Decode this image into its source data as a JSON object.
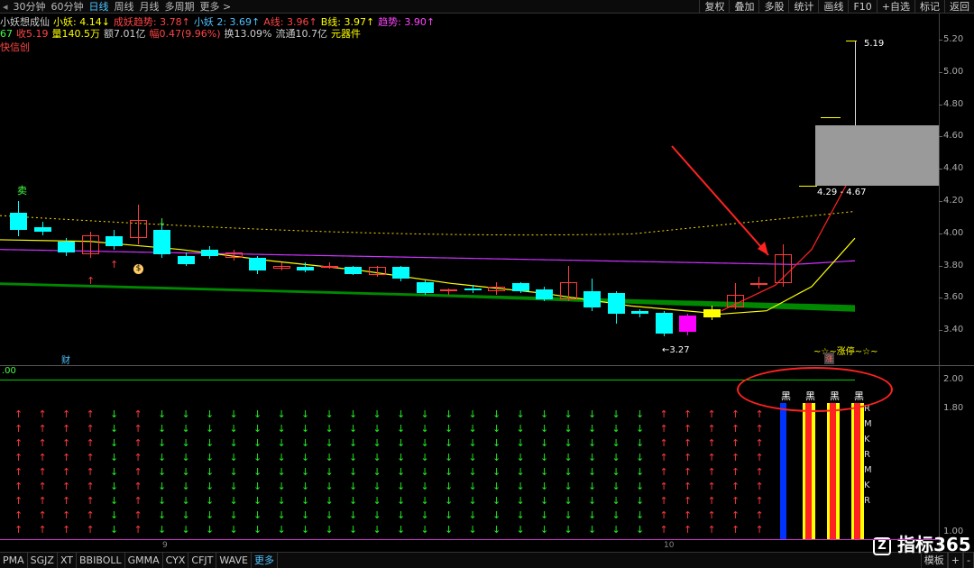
{
  "toolbar": {
    "periods": [
      "30分钟",
      "60分钟",
      "日线",
      "周线",
      "月线",
      "多周期",
      "更多 >"
    ],
    "active_period": "日线",
    "right_buttons": [
      "复权",
      "叠加",
      "多股",
      "统计",
      "画线",
      "F10",
      "+自选",
      "标记",
      "返回"
    ]
  },
  "indicators_line1": [
    {
      "text": "小妖想成仙",
      "color": "#cccccc"
    },
    {
      "text": "小妖: 4.14↓",
      "color": "#ffff00"
    },
    {
      "text": "成妖趋势: 3.78↑",
      "color": "#ff4444"
    },
    {
      "text": "小妖 2: 3.69↑",
      "color": "#4fc3ff"
    },
    {
      "text": "A线: 3.96↑",
      "color": "#ff4444"
    },
    {
      "text": "B线: 3.97↑",
      "color": "#ffff00"
    },
    {
      "text": "趋势: 3.90↑",
      "color": "#ff44ff"
    }
  ],
  "indicators_line2": [
    {
      "text": "67",
      "color": "#44ff44"
    },
    {
      "text": "收5.19",
      "color": "#ff4444"
    },
    {
      "text": "量140.5万",
      "color": "#ffff00"
    },
    {
      "text": "额7.01亿",
      "color": "#cccccc"
    },
    {
      "text": "幅0.47(9.96%)",
      "color": "#ff4444"
    },
    {
      "text": "换13.09%",
      "color": "#cccccc"
    },
    {
      "text": "流通10.7亿",
      "color": "#cccccc"
    },
    {
      "text": "元器件",
      "color": "#ffff00"
    }
  ],
  "indicator_line3": "快信创",
  "y_axis_main": [
    "5.20",
    "5.00",
    "4.80",
    "4.60",
    "4.40",
    "4.20",
    "4.00",
    "3.80",
    "3.60",
    "3.40"
  ],
  "y_axis_sub": [
    "2.00",
    "1.80",
    "1.00"
  ],
  "main_annotations": {
    "buy_label": "卖",
    "cai_label": "财",
    "low_label": "3.27",
    "high_label": "5.19",
    "range_label": "4.29 - 4.67",
    "zt_label": "~☆~涨停~☆~",
    "zt_sub": "涨",
    "money_icon": "$"
  },
  "sub_panel": {
    "left_label": ".00",
    "hei_labels": [
      "黑",
      "黑",
      "黑",
      "黑"
    ],
    "side_letters": [
      "R",
      "M",
      "K",
      "R",
      "M",
      "K",
      "R"
    ]
  },
  "x_labels": [
    "9",
    "10"
  ],
  "bottom_tabs": [
    "PMA",
    "SGJZ",
    "XT",
    "BBIBOLL",
    "GMMA",
    "CYX",
    "CFJT",
    "WAVE",
    "更多"
  ],
  "bottom_active": "更多",
  "bottom_right": [
    "模板",
    "+",
    "-"
  ],
  "watermark": "指标365",
  "colors": {
    "up": "#ff3b3b",
    "down": "#00ffff",
    "green_band": "#008800",
    "ma_yellow": "#ffff00",
    "ma_purple": "#cc33ff",
    "blue_bar": "#0033ff"
  }
}
